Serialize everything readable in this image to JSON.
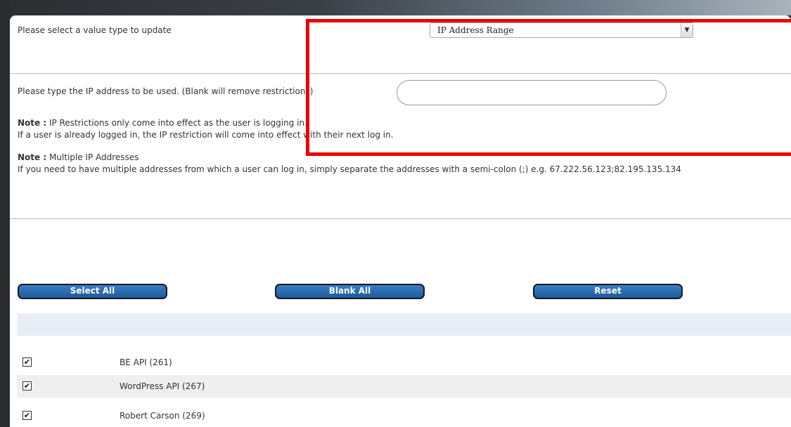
{
  "form": {
    "value_type_label": "Please select a value type to update",
    "value_type_selected": "IP Address Range",
    "ip_label": "Please type the IP address to be used. (Blank will remove restrictions)",
    "ip_value": "",
    "note1_prefix": "Note :",
    "note1_line1": " IP Restrictions only come into effect as the user is logging in.",
    "note1_line2": "If a user is already logged in, the IP restriction will come into effect with their next log in.",
    "note2_prefix": "Note :",
    "note2_line1": " Multiple IP Addresses",
    "note2_line2": "If you need to have multiple addresses from which a user can log in, simply separate the addresses with a semi-colon (;) e.g. 67.222.56.123;82.195.135.134"
  },
  "buttons": {
    "select_all": "Select All",
    "blank_all": "Blank All",
    "reset": "Reset"
  },
  "users": [
    {
      "name": "BE API (261)",
      "checked": true
    },
    {
      "name": "WordPress API (267)",
      "checked": true
    },
    {
      "name": "Robert Carson (269)",
      "checked": true
    }
  ],
  "colors": {
    "button_blue": "#2a6db3",
    "highlight_red": "#ee0000",
    "band": "#e9eef6"
  }
}
